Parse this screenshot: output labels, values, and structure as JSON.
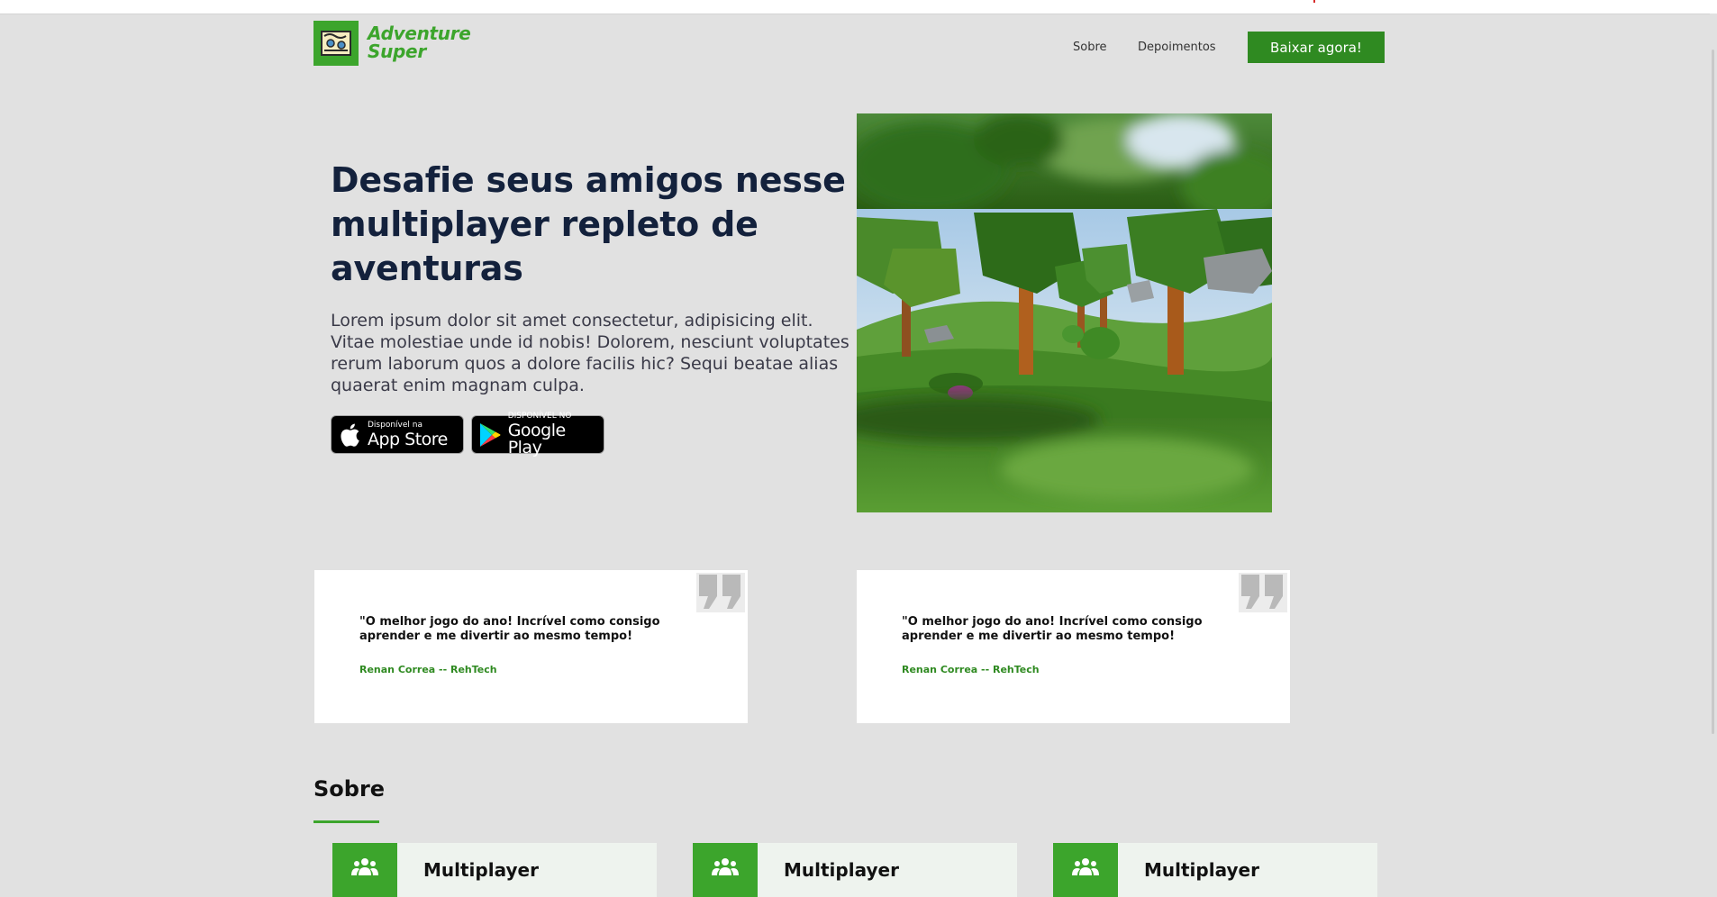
{
  "header": {
    "logo_line1": "Adventure",
    "logo_line2": "Super",
    "nav": [
      "Sobre",
      "Depoimentos"
    ],
    "cta_label": "Baixar agora!"
  },
  "hero": {
    "title": "Desafie seus amigos nesse multiplayer repleto de aventuras",
    "text": "Lorem ipsum dolor sit amet consectetur, adipisicing elit. Vitae molestiae unde id nobis! Dolorem, nesciunt voluptates rerum laborum quos a dolore facilis hic? Sequi beatae alias quaerat enim magnam culpa.",
    "app_store": {
      "small": "Disponível na",
      "big": "App Store"
    },
    "google_play": {
      "small": "DISPONÍVEL NO",
      "big": "Google Play"
    }
  },
  "testimonials": [
    {
      "quote": "\"O melhor jogo do ano! Incrível como consigo aprender e me divertir ao mesmo tempo!",
      "author": "Renan Correa -- RehTech"
    },
    {
      "quote": "\"O melhor jogo do ano! Incrível como consigo aprender e me divertir ao mesmo tempo!",
      "author": "Renan Correa -- RehTech"
    }
  ],
  "sobre": {
    "title": "Sobre",
    "features": [
      {
        "title": "Multiplayer",
        "icon": "users-icon"
      },
      {
        "title": "Multiplayer",
        "icon": "users-icon"
      },
      {
        "title": "Multiplayer",
        "icon": "users-icon"
      }
    ]
  },
  "colors": {
    "accent": "#3ca52c",
    "accent_dark": "#2f8a21",
    "title": "#13213c",
    "background": "#e1e1e1"
  }
}
